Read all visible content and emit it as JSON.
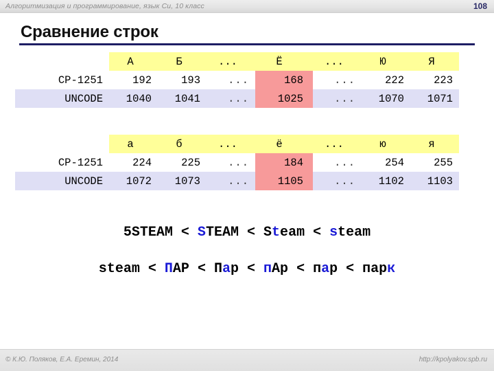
{
  "header": {
    "title": "Алгоритмизация и программирование, язык Си, 10 класс",
    "page_number": "108"
  },
  "slide": {
    "title": "Сравнение строк",
    "rule_color": "#1e1e64"
  },
  "tables": [
    {
      "name": "uppercase-table",
      "header_bg": "#ffff99",
      "highlight_bg": "#f79a9a",
      "unicode_row_bg": "#dfdff5",
      "columns": [
        "А",
        "Б",
        "...",
        "Ё",
        "...",
        "Ю",
        "Я"
      ],
      "rows": [
        {
          "label": "CP-1251",
          "values": [
            "192",
            "193",
            "...",
            "168",
            "...",
            "222",
            "223"
          ]
        },
        {
          "label": "UNCODE",
          "values": [
            "1040",
            "1041",
            "...",
            "1025",
            "...",
            "1070",
            "1071"
          ]
        }
      ],
      "highlight_column_index": 3
    },
    {
      "name": "lowercase-table",
      "header_bg": "#ffff99",
      "highlight_bg": "#f79a9a",
      "unicode_row_bg": "#dfdff5",
      "columns": [
        "а",
        "б",
        "...",
        "ё",
        "...",
        "ю",
        "я"
      ],
      "rows": [
        {
          "label": "CP-1251",
          "values": [
            "224",
            "225",
            "...",
            "184",
            "...",
            "254",
            "255"
          ]
        },
        {
          "label": "UNCODE",
          "values": [
            "1072",
            "1073",
            "...",
            "1105",
            "...",
            "1102",
            "1103"
          ]
        }
      ],
      "highlight_column_index": 3
    }
  ],
  "comparisons": {
    "accent_color": "#1a1ad6",
    "operator": "<",
    "line1": [
      {
        "plain": "5STEAM",
        "accent_index": -1
      },
      {
        "plain": "STEAM",
        "accent_index": 0
      },
      {
        "plain": "Steam",
        "accent_index": 1
      },
      {
        "plain": "steam",
        "accent_index": 0
      }
    ],
    "line2": [
      {
        "plain": "steam",
        "accent_index": -1
      },
      {
        "plain": "ПАР",
        "accent_index": 0
      },
      {
        "plain": "Пар",
        "accent_index": 1
      },
      {
        "plain": "пАр",
        "accent_index": 0
      },
      {
        "plain": "пар",
        "accent_index": 1
      },
      {
        "plain": "парк",
        "accent_index": 3
      }
    ]
  },
  "footer": {
    "copyright": "© К.Ю. Поляков, Е.А. Еремин, 2014",
    "url": "http://kpolyakov.spb.ru"
  }
}
